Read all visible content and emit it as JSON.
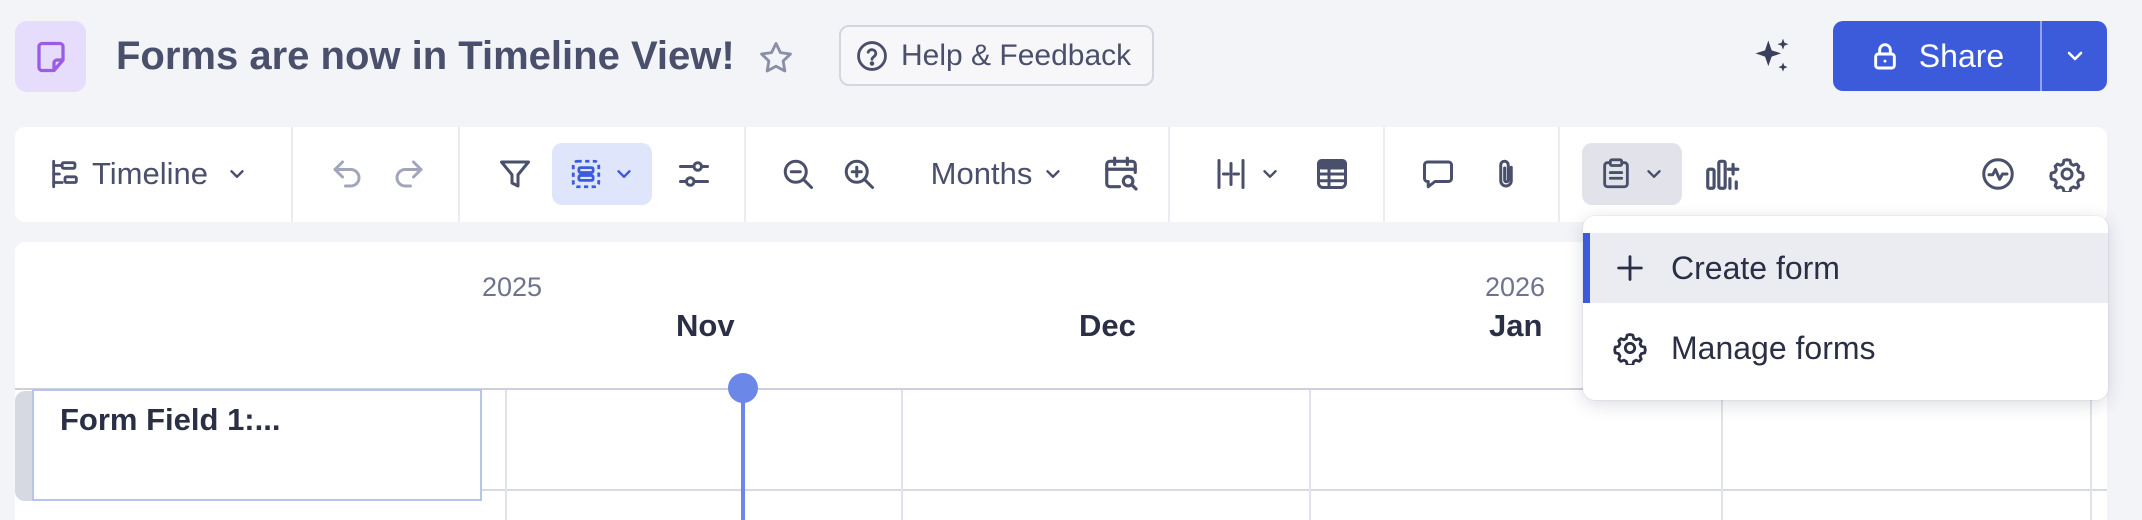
{
  "header": {
    "title": "Forms are now in Timeline View!",
    "help_label": "Help & Feedback",
    "share_label": "Share",
    "icons": {
      "app": "form-sheet-icon",
      "favorite": "star-icon",
      "help": "question-circle-icon",
      "ai": "sparkle-icon",
      "share": "lock-icon",
      "share_menu": "chevron-down-icon"
    }
  },
  "toolbar": {
    "view_label": "Timeline",
    "zoom_unit_label": "Months",
    "items": [
      "timeline-view-icon",
      "undo-icon",
      "redo-icon",
      "filter-icon",
      "group-by-icon",
      "adjust-icon",
      "zoom-out-icon",
      "zoom-in-icon",
      "scroll-to-date-icon",
      "column-width-icon",
      "grid-view-icon",
      "comment-icon",
      "attachment-icon",
      "form-icon",
      "chart-bars-icon",
      "activity-icon",
      "settings-gear-icon"
    ]
  },
  "timeline": {
    "years": [
      "2025",
      "2026"
    ],
    "months": [
      "Nov",
      "Dec",
      "Jan"
    ],
    "rows": [
      {
        "label": "Form Field 1:..."
      }
    ]
  },
  "dropdown": {
    "items": [
      {
        "label": "Create form",
        "icon": "plus-icon",
        "active": true
      },
      {
        "label": "Manage forms",
        "icon": "gear-icon",
        "active": false
      }
    ]
  },
  "colors": {
    "primary": "#3b5bdb",
    "app_icon_bg": "#e6dcfb",
    "app_icon": "#9b5de5",
    "today_marker": "#6b88e8",
    "active_tool_bg": "#dfe6fc",
    "page_bg": "#f3f4f8"
  }
}
